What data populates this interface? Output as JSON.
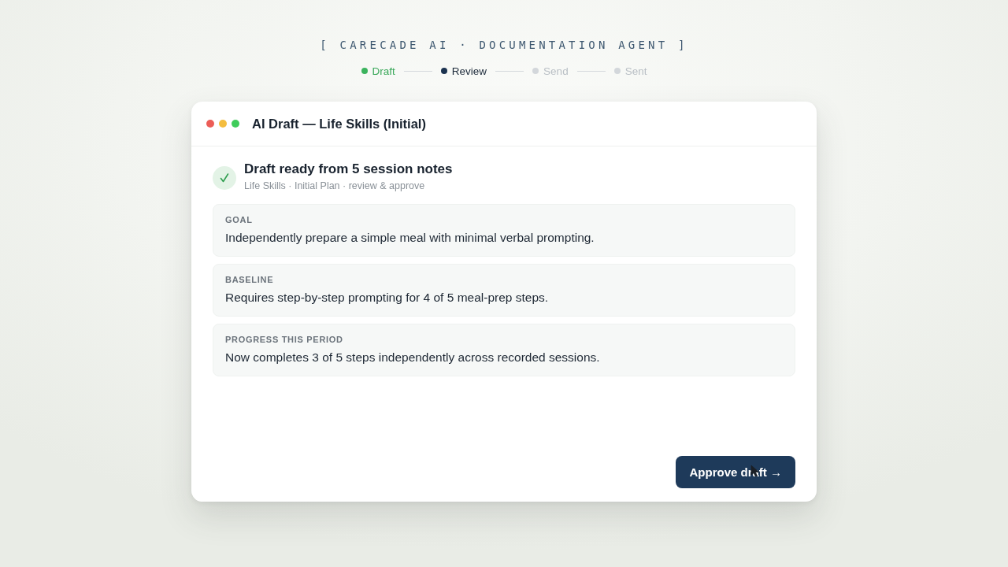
{
  "header": {
    "title": "[ CARECADE AI · DOCUMENTATION AGENT ]"
  },
  "steps": [
    {
      "label": "Draft",
      "done": true,
      "active": false
    },
    {
      "label": "Review",
      "done": false,
      "active": true
    },
    {
      "label": "Send",
      "done": false,
      "active": false
    },
    {
      "label": "Sent",
      "done": false,
      "active": false
    }
  ],
  "window": {
    "title": "AI Draft — Life Skills (Initial)"
  },
  "summary": {
    "title": "Draft ready from 5 session notes",
    "subtitle": "Life Skills · Initial Plan · review & approve"
  },
  "sections": [
    {
      "label": "GOAL",
      "text": "Independently prepare a simple meal with minimal verbal prompting."
    },
    {
      "label": "BASELINE",
      "text": "Requires step-by-step prompting for 4 of 5 meal-prep steps."
    },
    {
      "label": "PROGRESS THIS PERIOD",
      "text": "Now completes 3 of 5 steps independently across recorded sessions."
    }
  ],
  "primary_button": {
    "label": "Approve draft →"
  }
}
